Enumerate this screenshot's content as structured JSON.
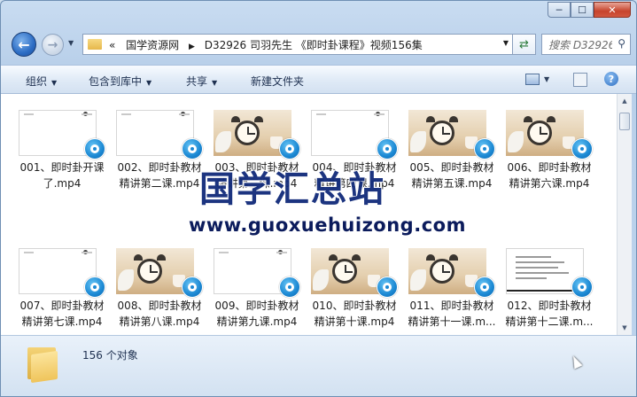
{
  "window": {
    "minimize": "─",
    "maximize": "☐",
    "close": "✕"
  },
  "nav": {
    "back": "←",
    "forward": "→",
    "address_prefix": "«",
    "address_parts": [
      "国学资源网",
      "D32926  司羽先生 《即时卦课程》视频156集"
    ],
    "search_placeholder": "搜索 D32926...",
    "icons": {
      "back": "back-arrow-icon",
      "forward": "forward-arrow-icon",
      "refresh": "refresh-icon",
      "search": "search-icon"
    }
  },
  "toolbar": {
    "organize": "组织",
    "include_in_library": "包含到库中",
    "share": "共享",
    "new_folder": "新建文件夹",
    "help": "?"
  },
  "files": [
    {
      "name": "001、即时卦开课了.mp4",
      "thumb": "blank"
    },
    {
      "name": "002、即时卦教材精讲第二课.mp4",
      "thumb": "blank"
    },
    {
      "name": "003、即时卦教材精讲第三课.mp4",
      "thumb": "clock"
    },
    {
      "name": "004、即时卦教材精讲第四课.mp4",
      "thumb": "blank"
    },
    {
      "name": "005、即时卦教材精讲第五课.mp4",
      "thumb": "clock"
    },
    {
      "name": "006、即时卦教材精讲第六课.mp4",
      "thumb": "clock"
    },
    {
      "name": "007、即时卦教材精讲第七课.mp4",
      "thumb": "blank"
    },
    {
      "name": "008、即时卦教材精讲第八课.mp4",
      "thumb": "clock"
    },
    {
      "name": "009、即时卦教材精讲第九课.mp4",
      "thumb": "blank"
    },
    {
      "name": "010、即时卦教材精讲第十课.mp4",
      "thumb": "clock"
    },
    {
      "name": "011、即时卦教材精讲第十一课.m...",
      "thumb": "clock"
    },
    {
      "name": "012、即时卦教材精讲第十二课.m...",
      "thumb": "slides"
    }
  ],
  "watermark": {
    "title": "国学汇总站",
    "url": "www.guoxuehuizong.com"
  },
  "status": {
    "count": "156 个对象"
  }
}
